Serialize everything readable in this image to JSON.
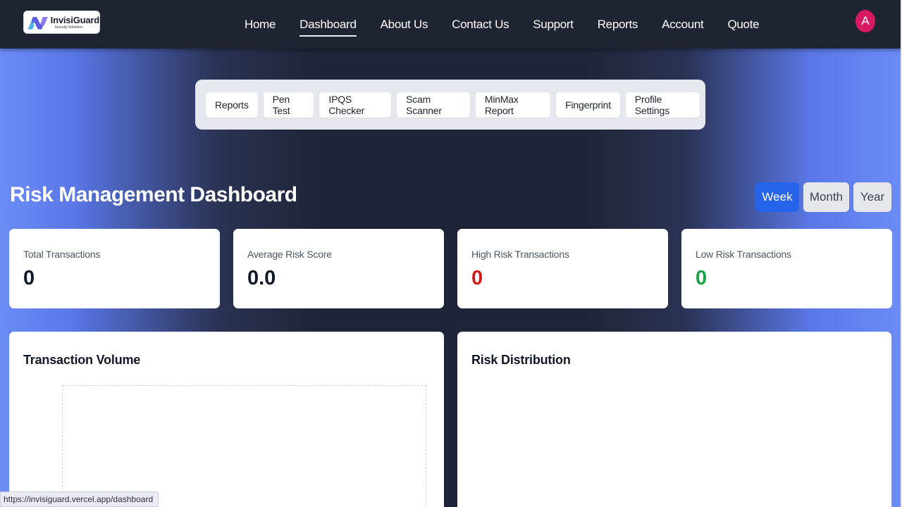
{
  "header": {
    "logo_title": "InvisiGuard",
    "logo_subtitle": "Security Solutions",
    "nav": [
      "Home",
      "Dashboard",
      "About Us",
      "Contact Us",
      "Support",
      "Reports",
      "Account",
      "Quote"
    ],
    "active_nav": "Dashboard",
    "avatar_initial": "A"
  },
  "subnav": [
    "Reports",
    "Pen Test",
    "IPQS Checker",
    "Scam Scanner",
    "MinMax Report",
    "Fingerprint",
    "Profile Settings"
  ],
  "dashboard": {
    "title": "Risk Management Dashboard",
    "periods": [
      "Week",
      "Month",
      "Year"
    ],
    "selected_period": "Week"
  },
  "stats": [
    {
      "label": "Total Transactions",
      "value": "0"
    },
    {
      "label": "Average Risk Score",
      "value": "0.0"
    },
    {
      "label": "High Risk Transactions",
      "value": "0"
    },
    {
      "label": "Low Risk Transactions",
      "value": "0"
    }
  ],
  "panels": {
    "volume_title": "Transaction Volume",
    "risk_title": "Risk Distribution"
  },
  "status_url": "https://invisiguard.vercel.app/dashboard",
  "colors": {
    "primary": "#2563eb",
    "high_risk": "#d11a1a",
    "low_risk": "#16a34a",
    "avatar": "#d81b60",
    "header_bg": "#1f2433"
  }
}
